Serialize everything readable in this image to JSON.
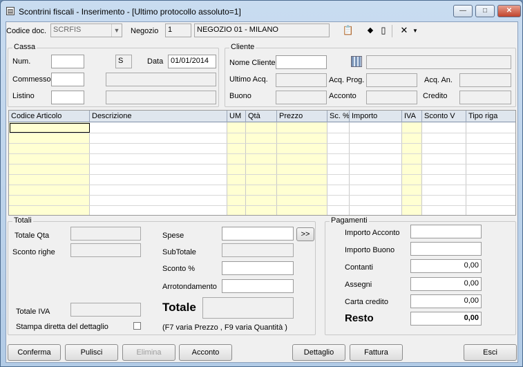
{
  "window": {
    "title": "Scontrini fiscali  - Inserimento  - [Ultimo protocollo assoluto=1]",
    "minimize": "—",
    "maximize": "□",
    "close": "✕"
  },
  "header": {
    "codice_doc_label": "Codice doc.",
    "codice_doc_value": "SCRFIS",
    "negozio_label": "Negozio",
    "negozio_code": "1",
    "negozio_name": "NEGOZIO 01 - MILANO"
  },
  "cassa": {
    "title": "Cassa",
    "num_label": "Num.",
    "num_value": "",
    "serie_value": "S",
    "data_label": "Data",
    "data_value": "01/01/2014",
    "commesso_label": "Commesso",
    "listino_label": "Listino"
  },
  "cliente": {
    "title": "Cliente",
    "nome_label": "Nome Cliente",
    "ultimo_acq_label": "Ultimo Acq.",
    "acq_prog_label": "Acq. Prog.",
    "acq_an_label": "Acq. An.",
    "buono_label": "Buono",
    "acconto_label": "Acconto",
    "credito_label": "Credito"
  },
  "grid": {
    "columns": [
      "Codice Articolo",
      "Descrizione",
      "UM",
      "Qtà",
      "Prezzo",
      "Sc. %",
      "Importo",
      "IVA",
      "Sconto V",
      "Tipo riga"
    ]
  },
  "totali": {
    "title": "Totali",
    "totale_qta_label": "Totale Qta",
    "sconto_righe_label": "Sconto righe",
    "totale_iva_label": "Totale IVA",
    "stampa_label": "Stampa diretta del dettaglio",
    "spese_label": "Spese",
    "subtotale_label": "SubTotale",
    "sconto_perc_label": "Sconto %",
    "arrotondamento_label": "Arrotondamento",
    "totale_label": "Totale",
    "expand_label": ">>",
    "hint": "(F7 varia Prezzo , F9 varia Quantità )"
  },
  "pagamenti": {
    "title": "Pagamenti",
    "importo_acconto_label": "Importo Acconto",
    "importo_buono_label": "Importo Buono",
    "contanti_label": "Contanti",
    "contanti_value": "0,00",
    "assegni_label": "Assegni",
    "assegni_value": "0,00",
    "carta_label": "Carta credito",
    "carta_value": "0,00",
    "resto_label": "Resto",
    "resto_value": "0,00"
  },
  "buttons": {
    "conferma": "Conferma",
    "pulisci": "Pulisci",
    "elimina": "Elimina",
    "acconto": "Acconto",
    "dettaglio": "Dettaglio",
    "fattura": "Fattura",
    "esci": "Esci"
  },
  "icons": [
    "clipboard-icon",
    "arrow-icon",
    "panel-icon",
    "cancel-icon"
  ]
}
